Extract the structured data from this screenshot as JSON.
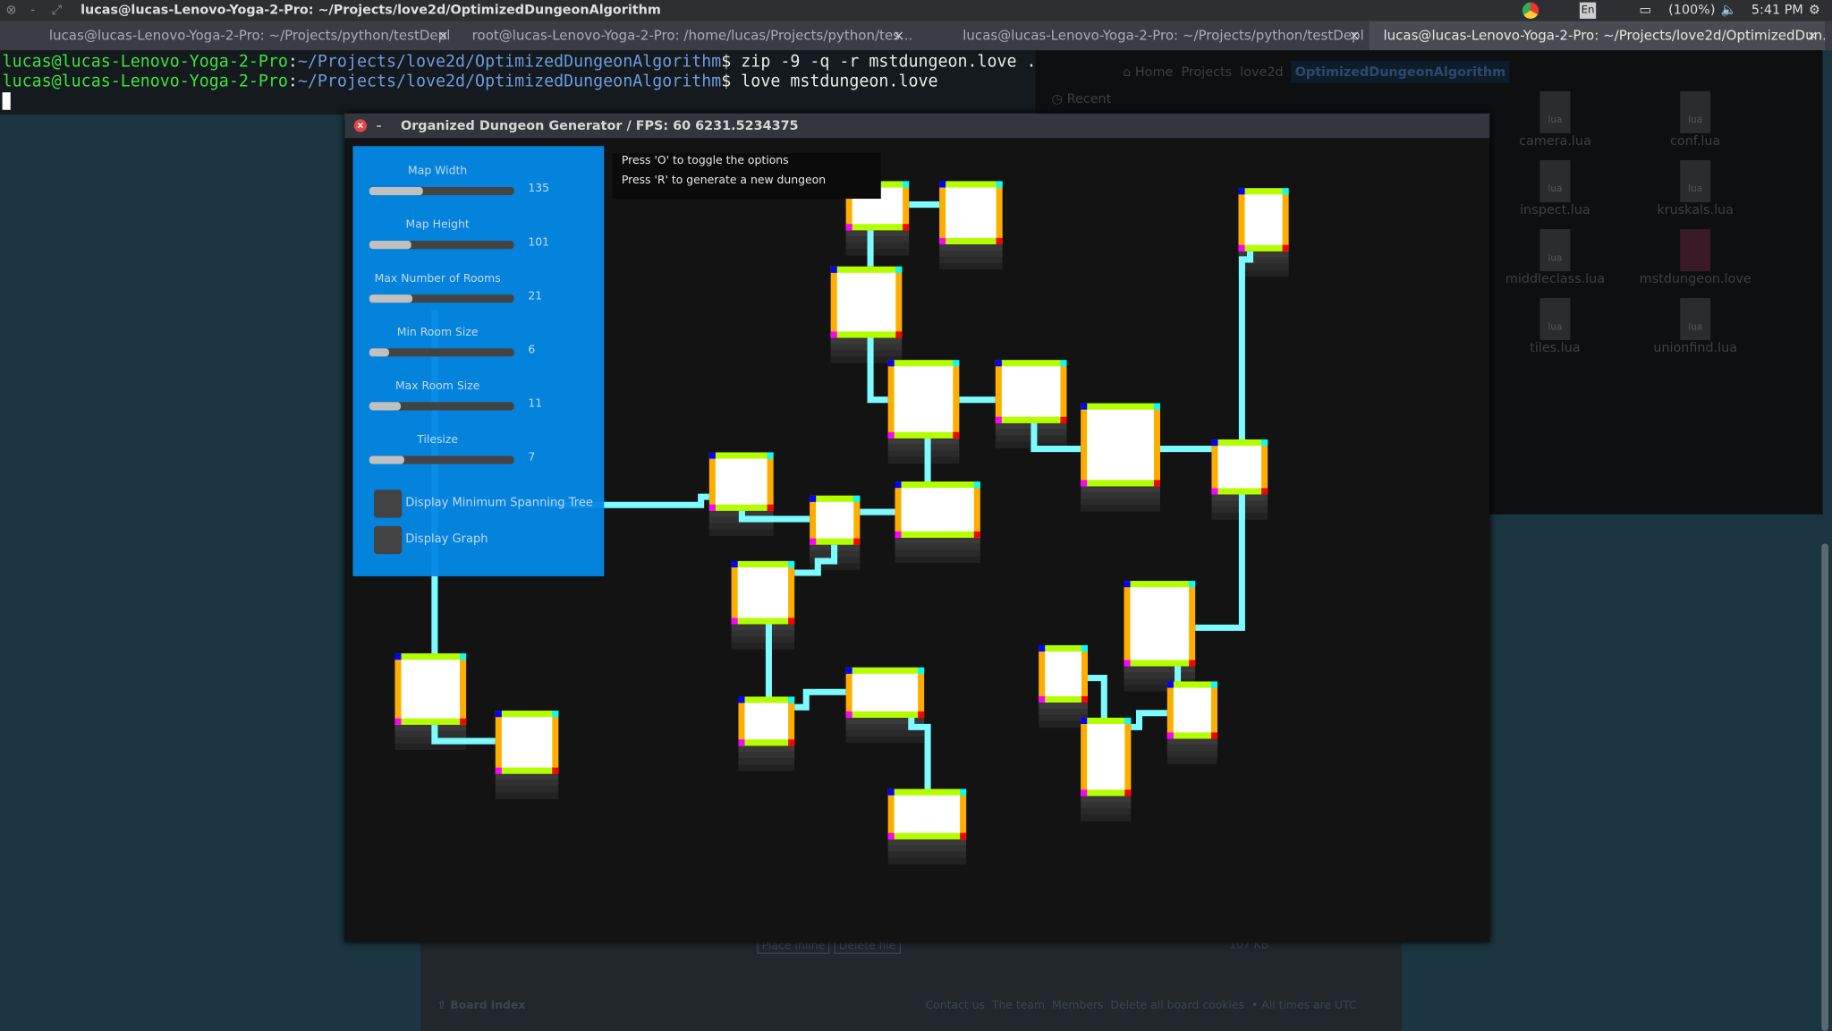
{
  "topbar": {
    "title": "lucas@lucas-Lenovo-Yoga-2-Pro: ~/Projects/love2d/OptimizedDungeonAlgorithm",
    "battery": "(100%)",
    "time": "5:41 PM",
    "keyboard": "En"
  },
  "tabs": [
    {
      "label": "lucas@lucas-Lenovo-Yoga-2-Pro: ~/Projects/python/testDepl"
    },
    {
      "label": "root@lucas-Lenovo-Yoga-2-Pro: /home/lucas/Projects/python/tes..."
    },
    {
      "label": "lucas@lucas-Lenovo-Yoga-2-Pro: ~/Projects/python/testDepl"
    },
    {
      "label": "lucas@lucas-Lenovo-Yoga-2-Pro: ~/Projects/love2d/OptimizedDun..."
    }
  ],
  "tab_close": "×",
  "terminal": {
    "prompt_user": "lucas@lucas-Lenovo-Yoga-2-Pro",
    "prompt_sep": ":",
    "prompt_path": "~/Projects/love2d/OptimizedDungeonAlgorithm",
    "lines": [
      {
        "cmd": "$ zip -9 -q -r mstdungeon.love ."
      },
      {
        "cmd": "$ love mstdungeon.love"
      }
    ]
  },
  "file_manager": {
    "breadcrumb": [
      "Home",
      "Projects",
      "love2d",
      "OptimizedDungeonAlgorithm"
    ],
    "sidebar": [
      "Recent"
    ],
    "files": [
      "camera.lua",
      "conf.lua",
      "inspect.lua",
      "kruskals.lua",
      "middleclass.lua",
      "mstdungeon.love",
      "tiles.lua",
      "unionfind.lua"
    ],
    "file_badge": "lua"
  },
  "forum": {
    "board_index": "Board index",
    "links": [
      "Contact us",
      "The team",
      "Members",
      "Delete all board cookies",
      "• All times are UTC"
    ],
    "buttons": [
      "Place inline",
      "Delete file"
    ],
    "size": "107 KB"
  },
  "game": {
    "title": "Organized Dungeon Generator / FPS: 60 6231.5234375",
    "help": [
      "Press 'O' to toggle the options",
      "Press 'R' to generate a new dungeon"
    ],
    "sliders": [
      {
        "label": "Map Width",
        "value": "135",
        "fill": 0.37
      },
      {
        "label": "Map Height",
        "value": "101",
        "fill": 0.29
      },
      {
        "label": "Max Number of Rooms",
        "value": "21",
        "fill": 0.3
      },
      {
        "label": "Min Room Size",
        "value": "6",
        "fill": 0.14
      },
      {
        "label": "Max Room Size",
        "value": "11",
        "fill": 0.22
      },
      {
        "label": "Tilesize",
        "value": "7",
        "fill": 0.24
      }
    ],
    "checkboxes": [
      {
        "label": "Display Minimum Spanning Tree",
        "checked": false
      },
      {
        "label": "Display Graph",
        "checked": false
      }
    ],
    "colors": {
      "panel": "#0488e6",
      "corridor": "#7dfcff",
      "wall_side": "#ffae00",
      "wall_top": "#b3ff00",
      "floor": "#ffffff"
    }
  }
}
